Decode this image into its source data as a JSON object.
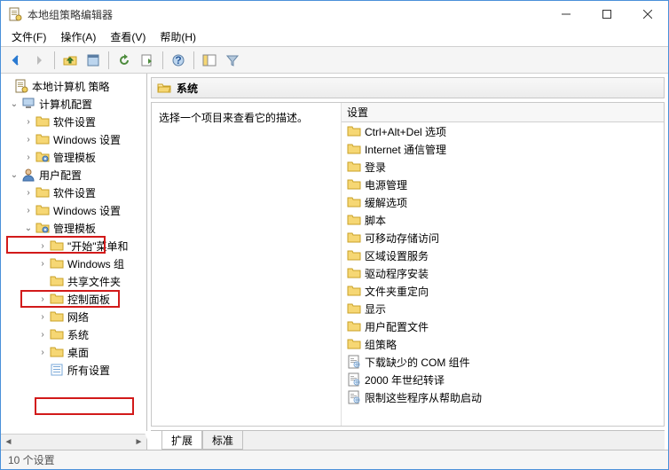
{
  "window": {
    "title": "本地组策略编辑器"
  },
  "menu": {
    "file": "文件(F)",
    "action": "操作(A)",
    "view": "查看(V)",
    "help": "帮助(H)"
  },
  "tree": {
    "root": "本地计算机 策略",
    "computer": {
      "label": "计算机配置",
      "software": "软件设置",
      "windows": "Windows 设置",
      "admin": "管理模板"
    },
    "user": {
      "label": "用户配置",
      "software": "软件设置",
      "windows": "Windows 设置",
      "admin": {
        "label": "管理模板",
        "startmenu": "\"开始\"菜单和",
        "wincomp": "Windows 组",
        "shared": "共享文件夹",
        "ctrlpanel": "控制面板",
        "network": "网络",
        "system": "系统",
        "desktop": "桌面",
        "all": "所有设置"
      }
    }
  },
  "right": {
    "header": "系统",
    "desc": "选择一个项目来查看它的描述。",
    "col": "设置",
    "items": [
      "Ctrl+Alt+Del 选项",
      "Internet 通信管理",
      "登录",
      "电源管理",
      "缓解选项",
      "脚本",
      "可移动存储访问",
      "区域设置服务",
      "驱动程序安装",
      "文件夹重定向",
      "显示",
      "用户配置文件",
      "组策略"
    ],
    "docitems": [
      "下载缺少的 COM 组件",
      "2000 年世纪转译",
      "限制这些程序从帮助启动"
    ]
  },
  "tabs": {
    "ext": "扩展",
    "std": "标准"
  },
  "status": "10 个设置"
}
